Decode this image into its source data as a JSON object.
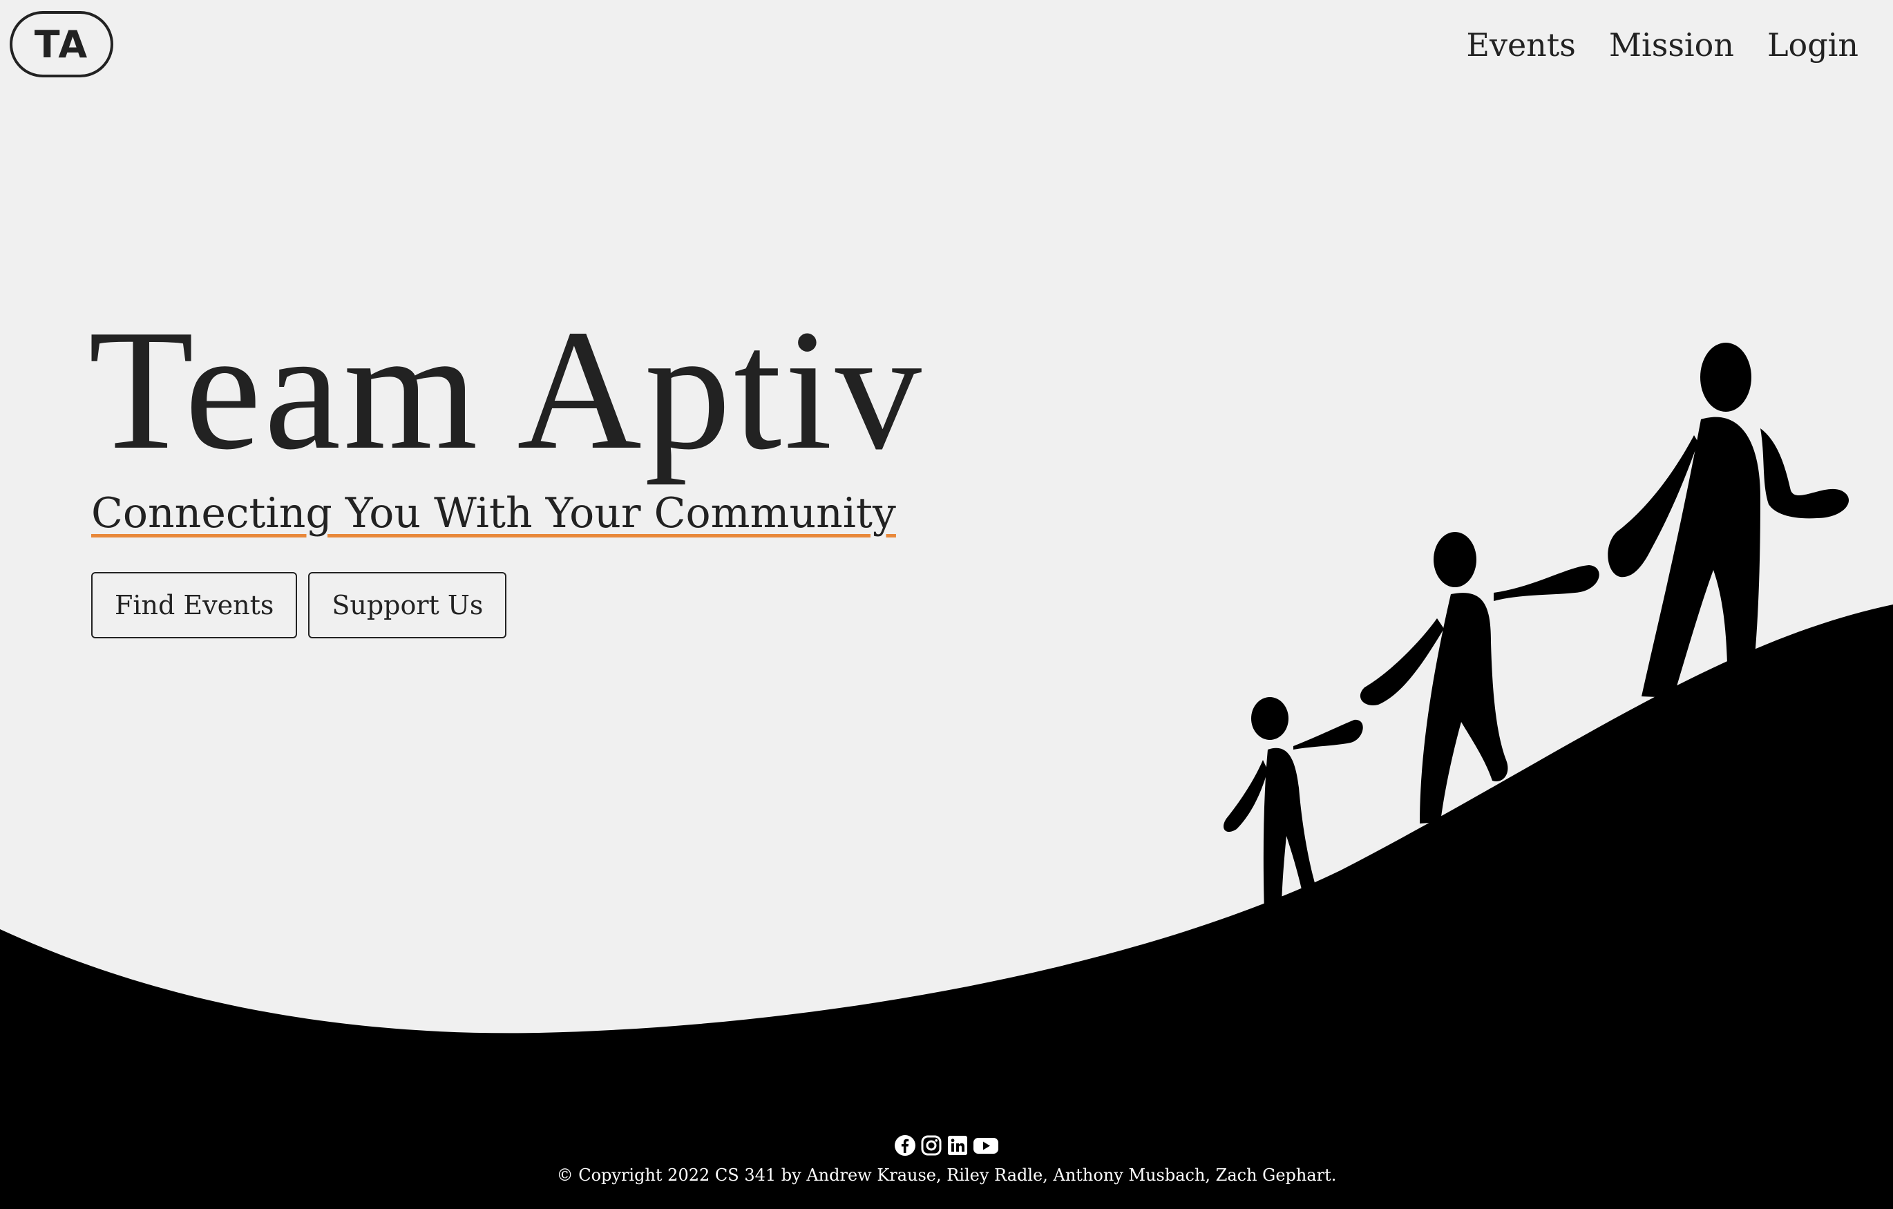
{
  "logo": {
    "text": "TA"
  },
  "nav": {
    "items": [
      {
        "label": "Events"
      },
      {
        "label": "Mission"
      },
      {
        "label": "Login"
      }
    ]
  },
  "hero": {
    "title": "Team Aptiv",
    "subtitle": "Connecting You With Your Community",
    "buttons": {
      "find_events": "Find Events",
      "support_us": "Support Us"
    }
  },
  "illustration": {
    "subject": "family-walking-uphill-silhouette"
  },
  "footer": {
    "social_icons": [
      "facebook-icon",
      "instagram-icon",
      "linkedin-icon",
      "youtube-icon"
    ],
    "copyright": "© Copyright 2022 CS 341 by Andrew Krause, Riley Radle, Anthony Musbach, Zach Gephart."
  },
  "colors": {
    "background": "#f0f0f0",
    "hill": "#000000",
    "text": "#222222",
    "accent_underline": "#e8883a"
  }
}
